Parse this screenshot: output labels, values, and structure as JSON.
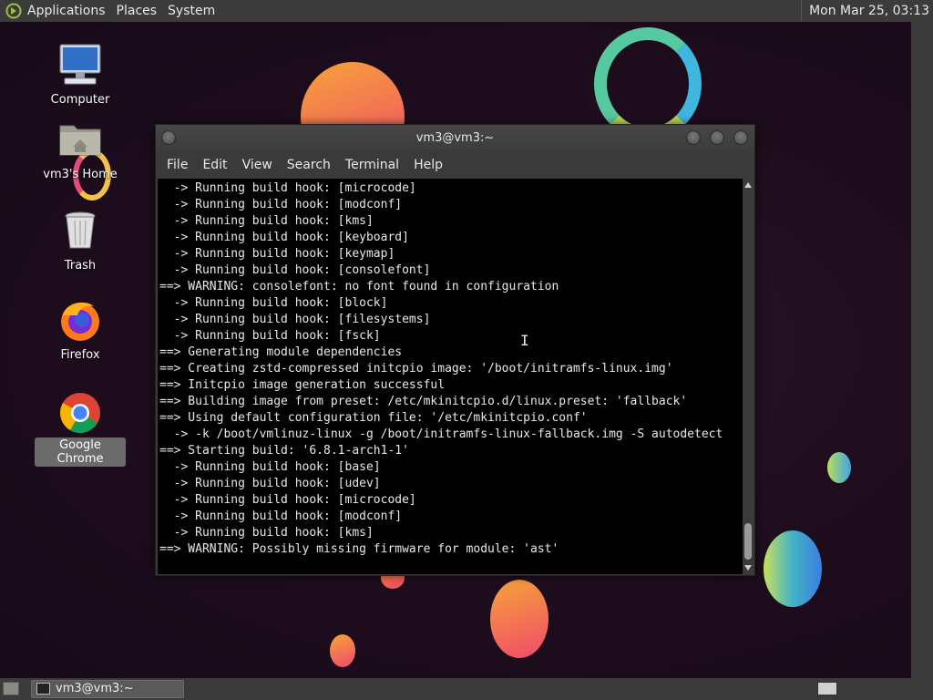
{
  "top_panel": {
    "menus": [
      "Applications",
      "Places",
      "System"
    ],
    "clock": "Mon Mar 25, 03:13"
  },
  "desktop_icons": {
    "computer": "Computer",
    "home": "vm3's Home",
    "trash": "Trash",
    "firefox": "Firefox",
    "chrome": "Google Chrome"
  },
  "terminal": {
    "title": "vm3@vm3:~",
    "menu": [
      "File",
      "Edit",
      "View",
      "Search",
      "Terminal",
      "Help"
    ],
    "lines": [
      "  -> Running build hook: [microcode]",
      "  -> Running build hook: [modconf]",
      "  -> Running build hook: [kms]",
      "  -> Running build hook: [keyboard]",
      "  -> Running build hook: [keymap]",
      "  -> Running build hook: [consolefont]",
      "==> WARNING: consolefont: no font found in configuration",
      "  -> Running build hook: [block]",
      "  -> Running build hook: [filesystems]",
      "  -> Running build hook: [fsck]",
      "==> Generating module dependencies",
      "==> Creating zstd-compressed initcpio image: '/boot/initramfs-linux.img'",
      "==> Initcpio image generation successful",
      "==> Building image from preset: /etc/mkinitcpio.d/linux.preset: 'fallback'",
      "==> Using default configuration file: '/etc/mkinitcpio.conf'",
      "  -> -k /boot/vmlinuz-linux -g /boot/initramfs-linux-fallback.img -S autodetect",
      "==> Starting build: '6.8.1-arch1-1'",
      "  -> Running build hook: [base]",
      "  -> Running build hook: [udev]",
      "  -> Running build hook: [microcode]",
      "  -> Running build hook: [modconf]",
      "  -> Running build hook: [kms]",
      "==> WARNING: Possibly missing firmware for module: 'ast'"
    ]
  },
  "taskbar": {
    "task_label": "vm3@vm3:~"
  },
  "colors": {
    "panel": "#3b3b3b",
    "terminal_bg": "#000000",
    "terminal_fg": "#e8e8e8"
  }
}
